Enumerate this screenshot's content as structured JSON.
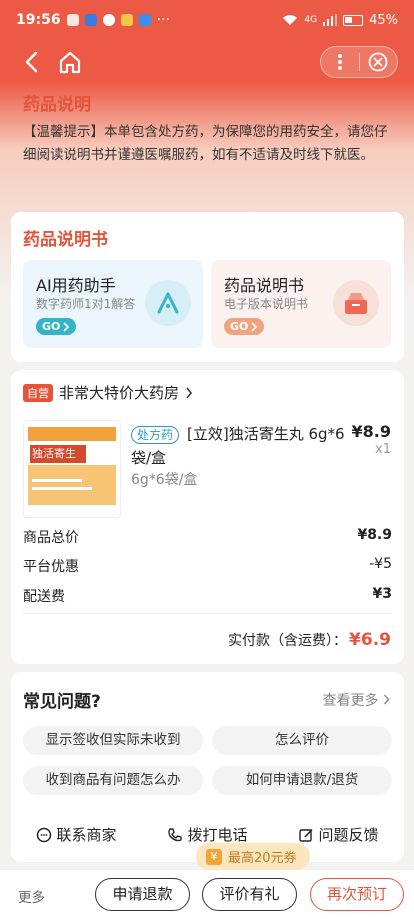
{
  "status_bar": {
    "time": "19:56",
    "more_dots": "···",
    "battery": "45%",
    "network": "4G"
  },
  "notice": {
    "title": "药品说明",
    "text": "【温馨提示】本单包含处方药，为保障您的用药安全，请您仔细阅读说明书并谨遵医嘱服药，如有不适请及时线下就医。"
  },
  "instructions": {
    "title": "药品说明书",
    "ai": {
      "title": "AI用药助手",
      "subtitle": "数字药师1对1解答",
      "go": "GO"
    },
    "doc": {
      "title": "药品说明书",
      "subtitle": "电子版本说明书",
      "go": "GO"
    }
  },
  "order": {
    "self_badge": "自营",
    "shop_name": "非常大特价大药房",
    "rx_tag": "处方药",
    "box_label": "独活寄生丸",
    "product_name": "[立效]独活寄生丸 6g*6袋/盒",
    "spec": "6g*6袋/盒",
    "price": "¥8.9",
    "qty": "x1",
    "fees": [
      {
        "label": "商品总价",
        "value": "¥8.9"
      },
      {
        "label": "平台优惠",
        "value": "-¥5"
      },
      {
        "label": "配送费",
        "value": "¥3"
      }
    ],
    "total_label": "实付款（含运费）：",
    "total_value": "¥6.9"
  },
  "faq": {
    "title": "常见问题?",
    "more": "查看更多",
    "chips": [
      "显示签收但实际未收到",
      "怎么评价",
      "收到商品有问题怎么办",
      "如何申请退款/退货"
    ],
    "actions": [
      "联系商家",
      "拨打电话",
      "问题反馈"
    ]
  },
  "coupon_tip": "最高20元券",
  "bottom_bar": {
    "more": "更多",
    "refund": "申请退款",
    "review": "评价有礼",
    "reorder": "再次预订"
  },
  "colors": {
    "brand": "#ec5a45",
    "accent": "#e4543b",
    "ai_blue": "#35b3c8"
  }
}
